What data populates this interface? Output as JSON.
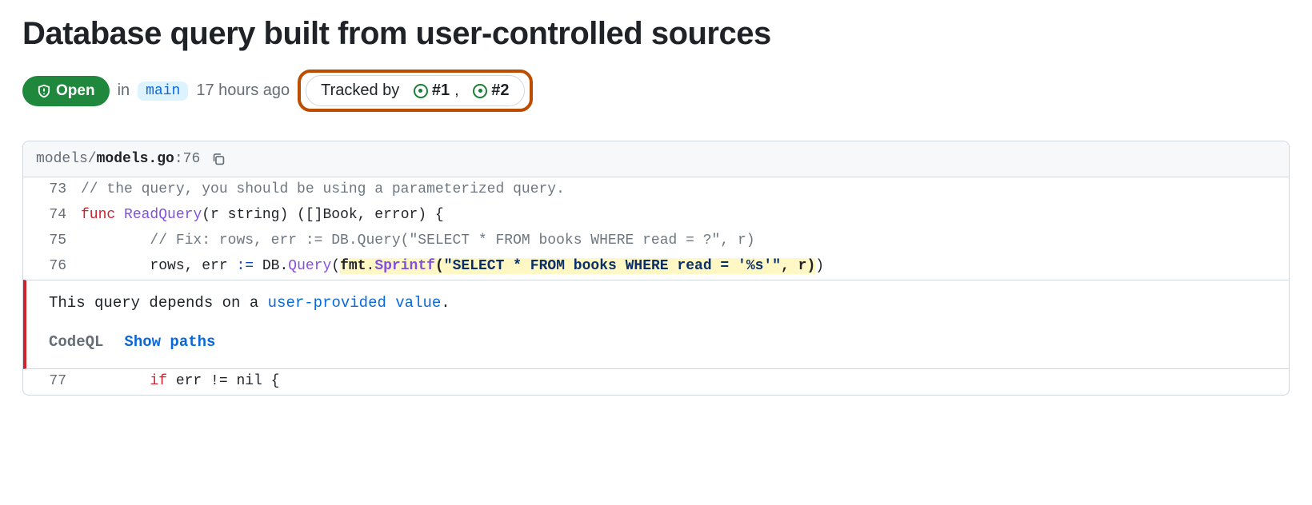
{
  "title": "Database query built from user-controlled sources",
  "status": {
    "label": "Open"
  },
  "in_label": "in",
  "branch": "main",
  "time_ago": "17 hours ago",
  "tracked_by": {
    "label": "Tracked by",
    "issues": [
      {
        "ref": "#1"
      },
      {
        "ref": "#2"
      }
    ],
    "separator": ","
  },
  "file": {
    "path_prefix": "models/",
    "filename": "models.go",
    "line_suffix": ":76"
  },
  "code": {
    "l73": {
      "no": "73",
      "comment": "// the query, you should be using a parameterized query."
    },
    "l74": {
      "no": "74",
      "kw_func": "func",
      "fn_name": "ReadQuery",
      "sig_rest": "(r string) ([]Book, error) {"
    },
    "l75": {
      "no": "75",
      "indent": "        ",
      "comment": "// Fix: rows, err := DB.Query(\"SELECT * FROM books WHERE read = ?\", r)"
    },
    "l76": {
      "no": "76",
      "indent": "        ",
      "pre": "rows, err ",
      "op": ":=",
      "mid": " DB.",
      "call1": "Query",
      "open1": "(",
      "hl_fmt": "fmt",
      "hl_dot": ".",
      "hl_sprintf": "Sprintf",
      "hl_open": "(",
      "hl_str": "\"SELECT * FROM books WHERE read = '%s'\"",
      "hl_rest": ", r)",
      "close": ")"
    },
    "l77": {
      "no": "77",
      "indent": "        ",
      "kw_if": "if",
      "rest": " err != nil {"
    }
  },
  "alert": {
    "msg_pre": "This query depends on a ",
    "msg_link": "user-provided value",
    "msg_post": ".",
    "codeql_label": "CodeQL",
    "show_paths": "Show paths"
  }
}
